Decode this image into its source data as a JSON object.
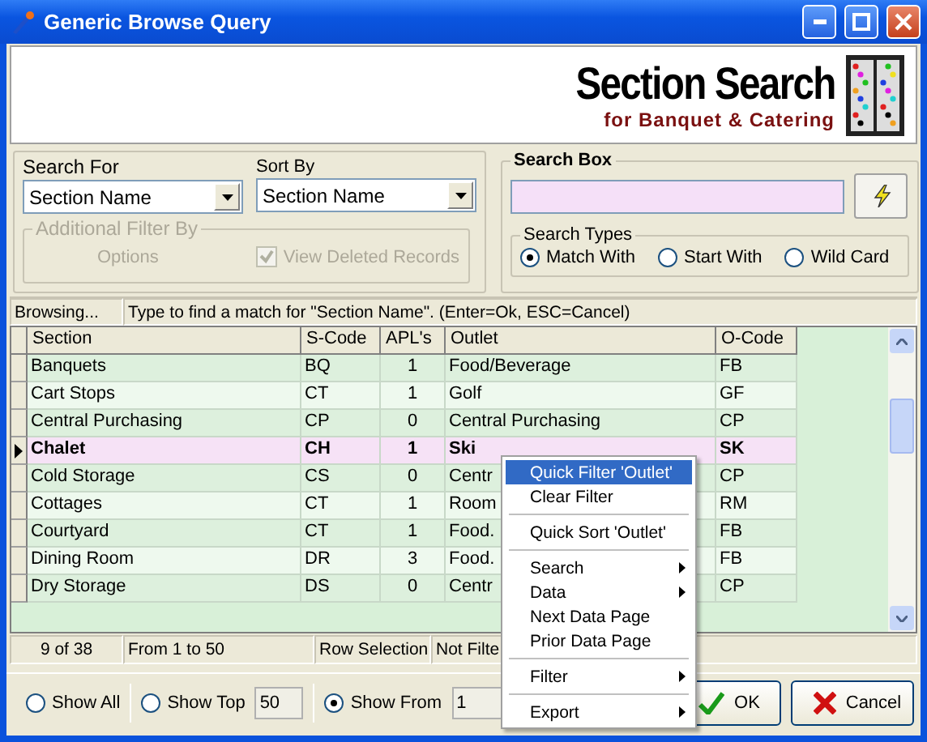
{
  "window": {
    "title": "Generic Browse Query"
  },
  "header": {
    "title": "Section Search",
    "subtitle": "for Banquet & Catering"
  },
  "search_for": {
    "label": "Search For",
    "value": "Section Name"
  },
  "sort_by": {
    "label": "Sort By",
    "value": "Section Name"
  },
  "additional_filter": {
    "label": "Additional Filter By",
    "disabled": true,
    "options_label": "Options",
    "view_deleted": {
      "label": "View Deleted Records",
      "checked": true
    }
  },
  "search_box": {
    "label": "Search Box"
  },
  "search_types": {
    "label": "Search Types",
    "options": [
      {
        "label": "Match With",
        "selected": true
      },
      {
        "label": "Start With",
        "selected": false
      },
      {
        "label": "Wild Card",
        "selected": false
      }
    ]
  },
  "browse_bar": {
    "status": "Browsing...",
    "hint": "Type to find a match for \"Section Name\". (Enter=Ok, ESC=Cancel)"
  },
  "table": {
    "columns": [
      "Section",
      "S-Code",
      "APL's",
      "Outlet",
      "O-Code"
    ],
    "rows": [
      {
        "cells": [
          "Banquets",
          "BQ",
          "1",
          "Food/Beverage",
          "FB"
        ],
        "selected": false
      },
      {
        "cells": [
          "Cart Stops",
          "CT",
          "1",
          "Golf",
          "GF"
        ],
        "selected": false
      },
      {
        "cells": [
          "Central Purchasing",
          "CP",
          "0",
          "Central Purchasing",
          "CP"
        ],
        "selected": false
      },
      {
        "cells": [
          "Chalet",
          "CH",
          "1",
          "Ski",
          "SK"
        ],
        "selected": true
      },
      {
        "cells": [
          "Cold Storage",
          "CS",
          "0",
          "Centr",
          "CP"
        ],
        "selected": false
      },
      {
        "cells": [
          "Cottages",
          "CT",
          "1",
          "Room",
          "RM"
        ],
        "selected": false
      },
      {
        "cells": [
          "Courtyard",
          "CT",
          "1",
          "Food.",
          "FB"
        ],
        "selected": false
      },
      {
        "cells": [
          "Dining Room",
          "DR",
          "3",
          "Food.",
          "FB"
        ],
        "selected": false
      },
      {
        "cells": [
          "Dry Storage",
          "DS",
          "0",
          "Centr",
          "CP"
        ],
        "selected": false
      }
    ]
  },
  "status_bar": [
    "9 of 38",
    "From 1 to 50",
    "Row Selection",
    "Not Filte"
  ],
  "show_options": [
    {
      "label": "Show All",
      "selected": false
    },
    {
      "label": "Show Top",
      "selected": false,
      "value": "50"
    },
    {
      "label": "Show From",
      "selected": true,
      "value": "1"
    }
  ],
  "buttons": [
    {
      "label": "OK",
      "kind": "ok"
    },
    {
      "label": "Cancel",
      "kind": "cancel"
    }
  ],
  "context_menu": {
    "items": [
      {
        "kind": "item",
        "label": "Quick Filter 'Outlet'",
        "highlighted": true,
        "submenu": false
      },
      {
        "kind": "item",
        "label": "Clear Filter",
        "highlighted": false,
        "submenu": false
      },
      {
        "kind": "separator"
      },
      {
        "kind": "item",
        "label": "Quick Sort 'Outlet'",
        "highlighted": false,
        "submenu": false
      },
      {
        "kind": "separator"
      },
      {
        "kind": "item",
        "label": "Search",
        "highlighted": false,
        "submenu": true
      },
      {
        "kind": "item",
        "label": "Data",
        "highlighted": false,
        "submenu": true
      },
      {
        "kind": "item",
        "label": "Next Data Page",
        "highlighted": false,
        "submenu": false
      },
      {
        "kind": "item",
        "label": "Prior Data Page",
        "highlighted": false,
        "submenu": false
      },
      {
        "kind": "separator"
      },
      {
        "kind": "item",
        "label": "Filter",
        "highlighted": false,
        "submenu": true
      },
      {
        "kind": "separator"
      },
      {
        "kind": "item",
        "label": "Export",
        "highlighted": false,
        "submenu": true
      }
    ]
  }
}
